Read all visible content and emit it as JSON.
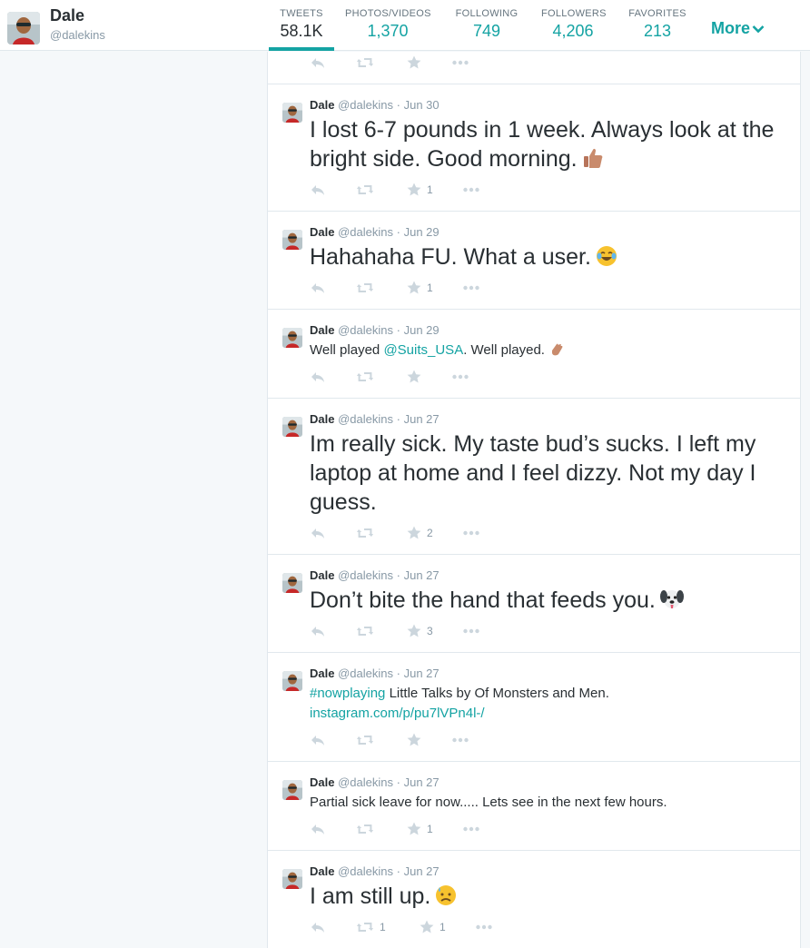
{
  "profile": {
    "name": "Dale",
    "handle": "@dalekins"
  },
  "stats": [
    {
      "label": "TWEETS",
      "value": "58.1K",
      "active": true
    },
    {
      "label": "PHOTOS/VIDEOS",
      "value": "1,370"
    },
    {
      "label": "FOLLOWING",
      "value": "749"
    },
    {
      "label": "FOLLOWERS",
      "value": "4,206"
    },
    {
      "label": "FAVORITES",
      "value": "213"
    }
  ],
  "more_label": "More",
  "colors": {
    "accent": "#14a3a3",
    "text": "#292f33",
    "muted": "#8899a6",
    "icon": "#ccd6dd",
    "background": "#f5f8fa"
  },
  "tweets": [
    {
      "name": "Dale",
      "handle": "@dalekins",
      "dot": "·",
      "date": "Jun 30",
      "text": "I lost 6-7 pounds in 1 week. Always look at the bright side. Good morning.",
      "emoji": "thumbs-up-icon",
      "retweets": "",
      "favorites": "1"
    },
    {
      "name": "Dale",
      "handle": "@dalekins",
      "dot": "·",
      "date": "Jun 29",
      "text": "Hahahaha FU. What a user.",
      "emoji": "tears-of-joy-icon",
      "retweets": "",
      "favorites": "1"
    },
    {
      "name": "Dale",
      "handle": "@dalekins",
      "dot": "·",
      "date": "Jun 29",
      "text_pre": "Well played ",
      "mention": "@Suits_USA",
      "text_post": ". Well played.",
      "emoji": "clapping-icon",
      "retweets": "",
      "favorites": ""
    },
    {
      "name": "Dale",
      "handle": "@dalekins",
      "dot": "·",
      "date": "Jun 27",
      "text": "Im really sick. My taste bud’s sucks. I left my laptop at home and I feel dizzy. Not my day I guess.",
      "retweets": "",
      "favorites": "2"
    },
    {
      "name": "Dale",
      "handle": "@dalekins",
      "dot": "·",
      "date": "Jun 27",
      "text": "Don’t bite the hand that feeds you.",
      "emoji": "dog-face-icon",
      "retweets": "",
      "favorites": "3"
    },
    {
      "name": "Dale",
      "handle": "@dalekins",
      "dot": "·",
      "date": "Jun 27",
      "hashtag": "#nowplaying",
      "text_post": " Little Talks by Of Monsters and Men.",
      "url": "instagram.com/p/pu7lVPn4l-/",
      "retweets": "",
      "favorites": ""
    },
    {
      "name": "Dale",
      "handle": "@dalekins",
      "dot": "·",
      "date": "Jun 27",
      "text": "Partial sick leave for now..... Lets see in the next few hours.",
      "retweets": "",
      "favorites": "1"
    },
    {
      "name": "Dale",
      "handle": "@dalekins",
      "dot": "·",
      "date": "Jun 27",
      "text": "I am still up.",
      "emoji": "sad-relieved-face-icon",
      "retweets": "1",
      "favorites": "1"
    }
  ]
}
